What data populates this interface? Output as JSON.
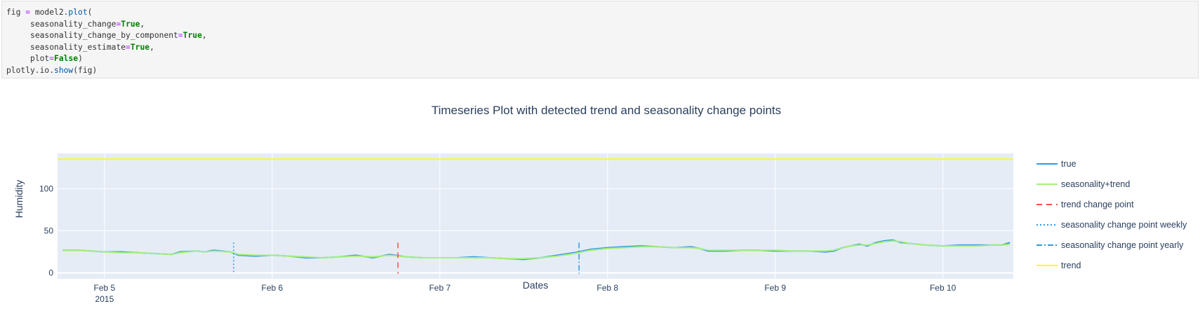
{
  "code": {
    "line1": {
      "var": "fig",
      "op": " = ",
      "obj": "model2.",
      "fn": "plot",
      "rest": "("
    },
    "line2": {
      "arg": "seasonality_change",
      "eq": "=",
      "val": "True",
      "tail": ","
    },
    "line3": {
      "arg": "seasonality_change_by_component",
      "eq": "=",
      "val": "True",
      "tail": ","
    },
    "line4": {
      "arg": "seasonality_estimate",
      "eq": "=",
      "val": "True",
      "tail": ","
    },
    "line5": {
      "arg": "plot",
      "eq": "=",
      "val": "False",
      "tail": ")"
    },
    "line6": {
      "obj": "plotly.io.",
      "fn": "show",
      "rest": "(fig)"
    }
  },
  "chart_data": {
    "type": "line",
    "title": "Timeseries Plot with detected trend and seasonality change points",
    "xlabel": "Dates",
    "ylabel": "Humidity",
    "xlim": [
      4.72,
      10.42
    ],
    "ylim": [
      -7,
      142
    ],
    "yticks": [
      0,
      50,
      100
    ],
    "xticks": [
      {
        "x": 5,
        "label": "Feb 5",
        "sub": "2015"
      },
      {
        "x": 6,
        "label": "Feb 6",
        "sub": ""
      },
      {
        "x": 7,
        "label": "Feb 7",
        "sub": ""
      },
      {
        "x": 8,
        "label": "Feb 8",
        "sub": ""
      },
      {
        "x": 9,
        "label": "Feb 9",
        "sub": ""
      },
      {
        "x": 10,
        "label": "Feb 10",
        "sub": ""
      }
    ],
    "grid": true,
    "legend_position": "right",
    "series": [
      {
        "name": "true",
        "color": "#3498db",
        "dash": "solid",
        "x": [
          4.75,
          4.85,
          5.0,
          5.1,
          5.2,
          5.3,
          5.4,
          5.45,
          5.55,
          5.6,
          5.65,
          5.75,
          5.8,
          5.9,
          6.0,
          6.1,
          6.2,
          6.3,
          6.4,
          6.5,
          6.6,
          6.7,
          6.8,
          6.9,
          7.0,
          7.1,
          7.2,
          7.3,
          7.4,
          7.5,
          7.6,
          7.7,
          7.8,
          7.9,
          8.0,
          8.1,
          8.2,
          8.3,
          8.4,
          8.5,
          8.55,
          8.6,
          8.7,
          8.8,
          8.9,
          9.0,
          9.1,
          9.2,
          9.3,
          9.35,
          9.4,
          9.45,
          9.5,
          9.55,
          9.6,
          9.65,
          9.7,
          9.75,
          9.8,
          9.9,
          10.0,
          10.1,
          10.2,
          10.3,
          10.35,
          10.4
        ],
        "y": [
          27,
          27,
          25,
          25,
          24,
          23,
          22,
          25,
          26,
          25,
          27,
          25,
          21,
          20,
          21,
          20,
          18,
          18,
          19,
          21,
          18,
          22,
          19,
          18,
          18,
          18,
          19,
          18,
          17,
          16,
          18,
          21,
          24,
          28,
          30,
          31,
          32,
          31,
          30,
          31,
          29,
          26,
          26,
          27,
          27,
          26,
          26,
          26,
          25,
          26,
          30,
          32,
          34,
          32,
          36,
          38,
          39,
          36,
          35,
          33,
          32,
          33,
          33,
          33,
          33,
          36
        ]
      },
      {
        "name": "seasonality+trend",
        "color": "#a4f07a",
        "dash": "solid",
        "x": [
          4.75,
          4.85,
          5.0,
          5.1,
          5.2,
          5.3,
          5.4,
          5.45,
          5.55,
          5.6,
          5.65,
          5.75,
          5.8,
          5.9,
          6.0,
          6.1,
          6.2,
          6.3,
          6.4,
          6.5,
          6.6,
          6.7,
          6.8,
          6.9,
          7.0,
          7.1,
          7.2,
          7.3,
          7.4,
          7.5,
          7.6,
          7.7,
          7.8,
          7.9,
          8.0,
          8.1,
          8.2,
          8.3,
          8.4,
          8.5,
          8.55,
          8.6,
          8.7,
          8.8,
          8.9,
          9.0,
          9.1,
          9.2,
          9.3,
          9.35,
          9.4,
          9.45,
          9.5,
          9.55,
          9.6,
          9.65,
          9.7,
          9.75,
          9.8,
          9.9,
          10.0,
          10.1,
          10.2,
          10.3,
          10.35,
          10.4
        ],
        "y": [
          27,
          27,
          25,
          24,
          24,
          23,
          22,
          24,
          26,
          25,
          26,
          25,
          22,
          21,
          21,
          20,
          19,
          18,
          19,
          20,
          19,
          21,
          19,
          18,
          18,
          18,
          18,
          18,
          17,
          17,
          18,
          20,
          23,
          27,
          29,
          30,
          31,
          31,
          30,
          30,
          29,
          27,
          27,
          27,
          27,
          27,
          26,
          26,
          26,
          27,
          30,
          32,
          33,
          33,
          35,
          37,
          38,
          37,
          35,
          33,
          32,
          32,
          32,
          33,
          33,
          34
        ]
      }
    ],
    "vlines": [
      {
        "name": "trend change point",
        "color": "#ef553b",
        "dash": "dashed",
        "x": [
          6.75
        ]
      },
      {
        "name": "seasonality change point weekly",
        "color": "#3498db",
        "dash": "dotted",
        "x": [
          5.77
        ]
      },
      {
        "name": "seasonality change point yearly",
        "color": "#3498db",
        "dash": "dashdot",
        "x": [
          7.83
        ]
      }
    ],
    "hlines": [
      {
        "name": "trend",
        "color": "#ffff00",
        "y": 135
      }
    ],
    "legend": [
      {
        "name": "true",
        "color": "#3498db",
        "dash": "solid"
      },
      {
        "name": "seasonality+trend",
        "color": "#a4f07a",
        "dash": "solid"
      },
      {
        "name": "trend change point",
        "color": "#ef553b",
        "dash": "dashed"
      },
      {
        "name": "seasonality change point weekly",
        "color": "#3498db",
        "dash": "dotted"
      },
      {
        "name": "seasonality change point yearly",
        "color": "#3498db",
        "dash": "dashdot"
      },
      {
        "name": "trend",
        "color": "#ffff00",
        "dash": "solid"
      }
    ]
  }
}
